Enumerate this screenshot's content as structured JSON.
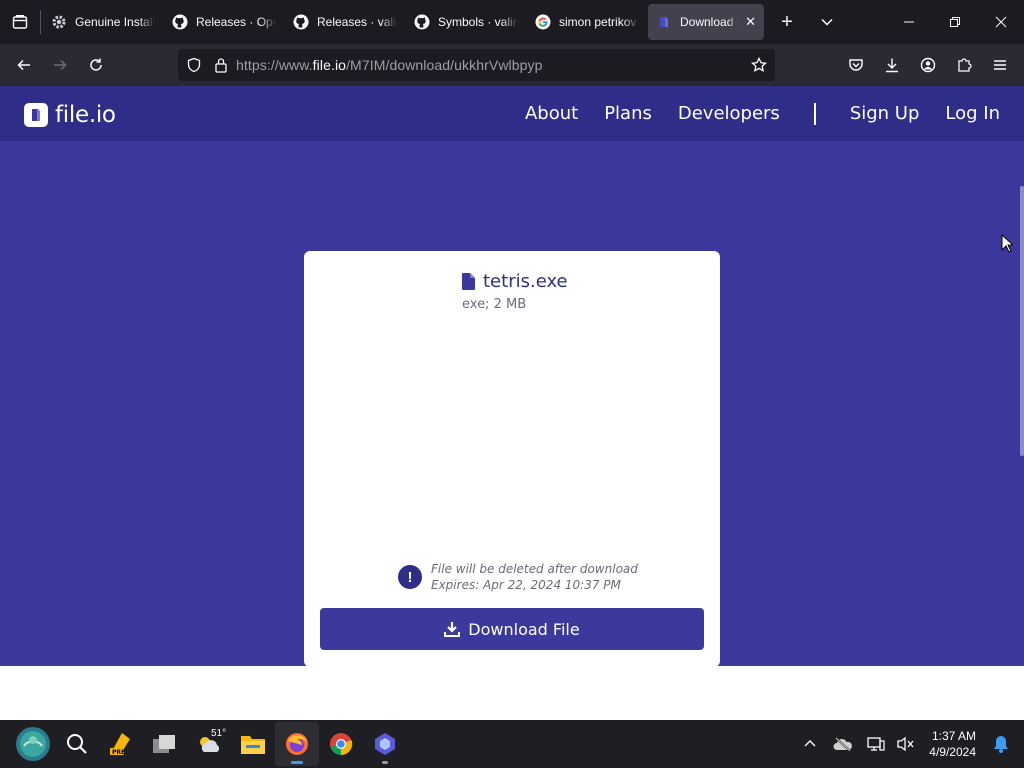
{
  "browser": {
    "tabs": [
      {
        "label": "Genuine Installation",
        "icon": "gear-icon"
      },
      {
        "label": "Releases · OpenBB",
        "icon": "github-icon"
      },
      {
        "label": "Releases · valinet",
        "icon": "github-icon"
      },
      {
        "label": "Symbols · valinet",
        "icon": "github-icon"
      },
      {
        "label": "simon petrikov",
        "icon": "google-icon"
      },
      {
        "label": "Download | file.io",
        "icon": "fileio-icon",
        "active": true
      }
    ],
    "url_prefix": "https://www.",
    "url_host": "file.io",
    "url_path": "/M7IM/download/ukkhrVwlbpyp"
  },
  "site": {
    "logo_text": "file.io",
    "nav": {
      "about": "About",
      "plans": "Plans",
      "developers": "Developers",
      "signup": "Sign Up",
      "login": "Log In"
    }
  },
  "file": {
    "name": "tetris.exe",
    "meta": "exe; 2 MB",
    "notice_line1": "File will be deleted after download",
    "notice_line2": "Expires: Apr 22, 2024 10:37 PM",
    "notice_icon_text": "!",
    "download_label": "Download File"
  },
  "taskbar": {
    "weather_temp": "51°",
    "time": "1:37 AM",
    "date": "4/9/2024"
  },
  "colors": {
    "page_bg": "#3b3a9c",
    "header_bg": "#2e2d87",
    "accent": "#3b3a9c"
  }
}
